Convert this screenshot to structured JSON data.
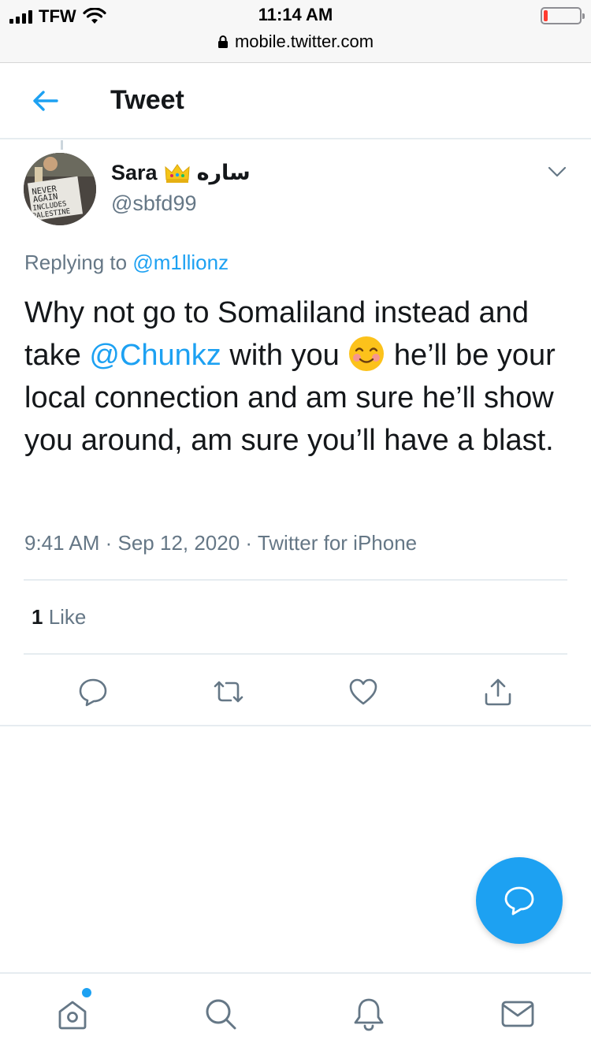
{
  "status_bar": {
    "carrier": "TFW",
    "time": "11:14 AM"
  },
  "browser": {
    "url": "mobile.twitter.com"
  },
  "header": {
    "title": "Tweet"
  },
  "tweet": {
    "display_name": "Sara",
    "display_name_arabic": "ساره",
    "handle": "@sbfd99",
    "replying_prefix": "Replying to",
    "replying_to": "@m1llionz",
    "text_part1": "Why not go to Somaliland instead and take ",
    "mention": "@Chunkz",
    "text_part2": " with you ",
    "text_part3": " he’ll be your local connection and am sure he’ll show you around, am sure you’ll have a blast.",
    "timestamp": "9:41 AM · Sep 12, 2020 · Twitter for iPhone",
    "like_count": "1",
    "like_label": " Like",
    "avatar_sign_text": [
      "NEVER",
      "AGAIN",
      "INCLUDES",
      "PALESTINE"
    ]
  },
  "icons": {
    "back": "arrow-left-icon",
    "caret": "chevron-down-icon",
    "reply": "reply-icon",
    "retweet": "retweet-icon",
    "like": "heart-icon",
    "share": "share-icon",
    "compose": "compose-reply-icon",
    "home": "home-icon",
    "search": "search-icon",
    "notifications": "bell-icon",
    "messages": "mail-icon"
  },
  "colors": {
    "accent": "#1da1f2",
    "text_primary": "#14171a",
    "text_secondary": "#657786",
    "divider": "#e6ecf0"
  }
}
